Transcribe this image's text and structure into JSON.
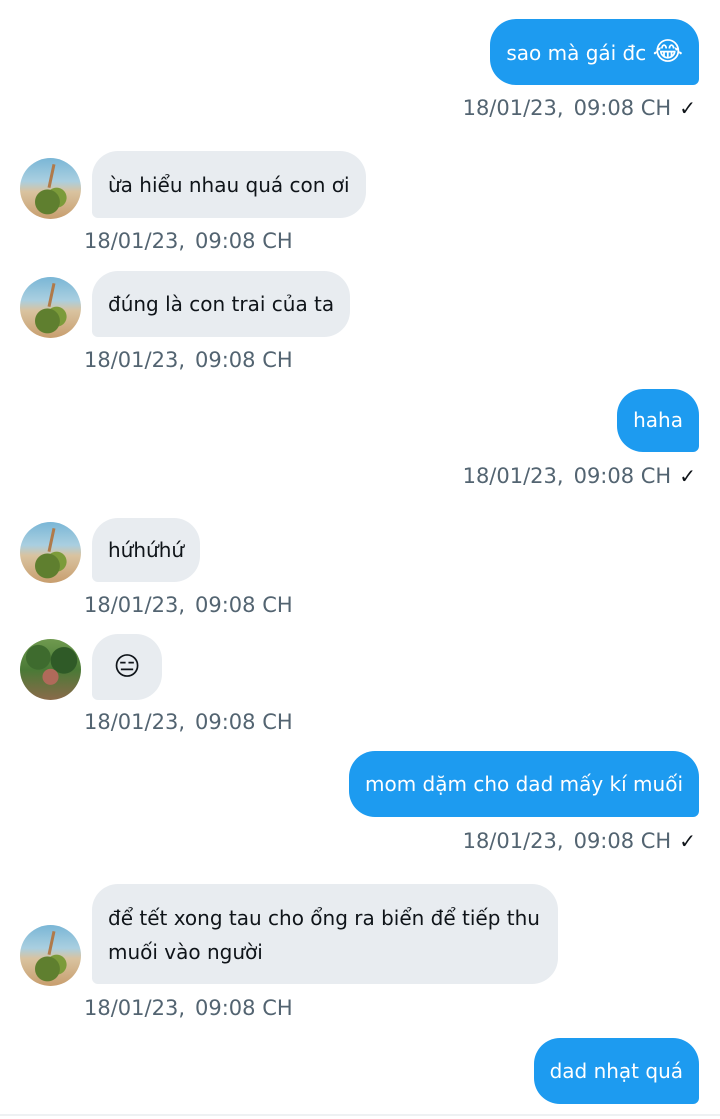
{
  "messages": [
    {
      "direction": "out",
      "text": "sao mà gái đc",
      "emoji": "😂",
      "date": "18/01/23,",
      "time": "09:08 CH",
      "check": "✓"
    },
    {
      "direction": "in",
      "text": "ừa hiểu nhau quá con ơi",
      "date": "18/01/23,",
      "time": "09:08 CH",
      "avatar_icon": "coconut-avatar"
    },
    {
      "direction": "in",
      "text": "đúng là con trai của ta",
      "date": "18/01/23,",
      "time": "09:08 CH",
      "avatar_icon": "coconut-avatar"
    },
    {
      "direction": "out",
      "text": "haha",
      "date": "18/01/23,",
      "time": "09:08 CH",
      "check": "✓"
    },
    {
      "direction": "in",
      "text": "hứhứhứ",
      "date": "18/01/23,",
      "time": "09:08 CH",
      "avatar_icon": "coconut-avatar"
    },
    {
      "direction": "in",
      "emoji": "😑",
      "date": "18/01/23,",
      "time": "09:08 CH",
      "avatar_icon": "forest-avatar"
    },
    {
      "direction": "out",
      "text": "mom dặm cho dad mấy kí muối",
      "date": "18/01/23,",
      "time": "09:08 CH",
      "check": "✓"
    },
    {
      "direction": "in",
      "text": "để tết xong tau cho ổng ra biển để tiếp thu muối vào người",
      "date": "18/01/23,",
      "time": "09:08 CH",
      "avatar_icon": "coconut-avatar"
    },
    {
      "direction": "out",
      "text": "dad nhạt quá"
    }
  ],
  "colors": {
    "outgoing_bubble": "#1d9bf0",
    "incoming_bubble": "#e8ecf0",
    "timestamp": "#536471"
  }
}
